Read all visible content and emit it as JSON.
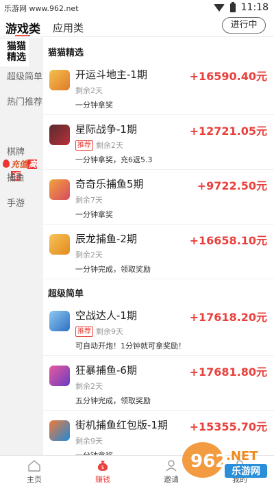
{
  "statusbar": {
    "source": "乐游网 www.962.net",
    "time": "11:18"
  },
  "topbar": {
    "tab_game": "游戏类",
    "tab_app": "应用类",
    "ongoing": "进行中"
  },
  "sidebar": {
    "active": "猫猫精选",
    "items": [
      "超级简单",
      "热门推荐",
      "棋牌",
      "捕鱼",
      "手游"
    ],
    "promo": {
      "prefix": "充值",
      "highlight": "高返"
    }
  },
  "sections": [
    {
      "title": "猫猫精选",
      "games": [
        {
          "title": "开运斗地主-1期",
          "price": "+16590.40元",
          "tag": "",
          "remain": "剩余2天",
          "desc": "一分钟拿奖",
          "icon_color": "#e07a2a",
          "icon": "card-game-icon"
        },
        {
          "title": "星际战争-1期",
          "price": "+12721.05元",
          "tag": "推荐",
          "remain": "剩余2天",
          "desc": "一分钟拿奖，充6返5.3",
          "icon_color": "#b8303a",
          "icon": "space-war-icon"
        },
        {
          "title": "奇奇乐捕鱼5期",
          "price": "+9722.50元",
          "tag": "",
          "remain": "剩余7天",
          "desc": "一分钟拿奖",
          "icon_color": "#d84a60",
          "icon": "fishing-icon"
        },
        {
          "title": "辰龙捕鱼-2期",
          "price": "+16658.10元",
          "tag": "",
          "remain": "剩余2天",
          "desc": "一分钟完成，领取奖励",
          "icon_color": "#e38a1c",
          "icon": "fishing-icon"
        }
      ]
    },
    {
      "title": "超级简单",
      "games": [
        {
          "title": "空战达人-1期",
          "price": "+17618.20元",
          "tag": "推荐",
          "remain": "剩余9天",
          "desc": "可自动开炮！1分钟就可拿奖励！",
          "icon_color": "#2c6fc2",
          "icon": "jet-icon"
        },
        {
          "title": "狂暴捕鱼-6期",
          "price": "+17681.80元",
          "tag": "",
          "remain": "剩余2天",
          "desc": "五分钟完成，领取奖励",
          "icon_color": "#6a3cc0",
          "icon": "fishing-icon"
        },
        {
          "title": "街机捕鱼红包版-1期",
          "price": "+15355.70元",
          "tag": "",
          "remain": "剩余9天",
          "desc": "一分钟拿奖",
          "icon_color": "#1e8ad8",
          "icon": "fishing-icon"
        }
      ]
    }
  ],
  "bottom_nav": [
    {
      "label": "主页",
      "icon": "home-icon"
    },
    {
      "label": "赚钱",
      "icon": "money-bag-icon"
    },
    {
      "label": "邀请",
      "icon": "user-icon"
    },
    {
      "label": "我的",
      "icon": "profile-icon"
    }
  ],
  "watermark": {
    "brand": "962",
    "domain": ".NET",
    "name": "乐游网"
  }
}
